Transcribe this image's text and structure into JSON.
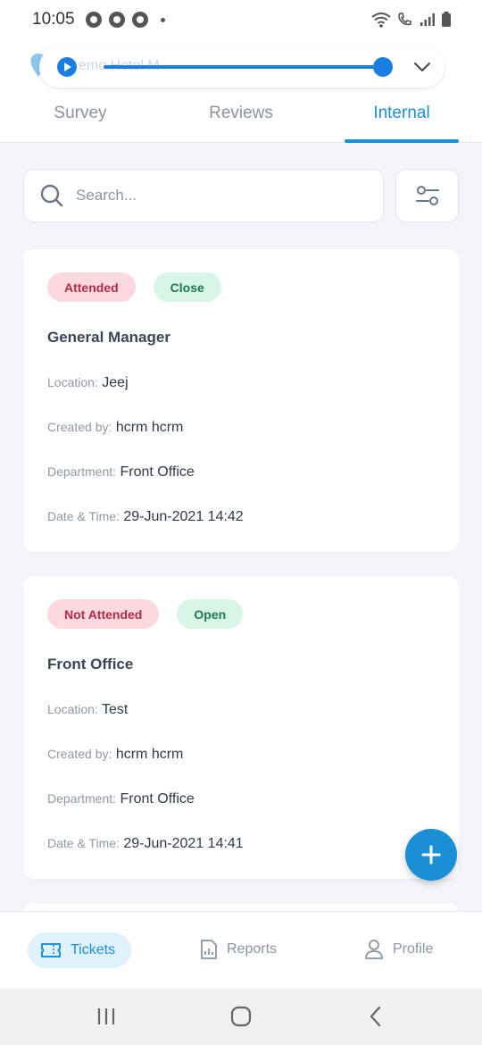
{
  "status_bar": {
    "time": "10:05"
  },
  "audio_player": {
    "title_partial": "emo Hotel M"
  },
  "tabs": [
    {
      "label": "Survey"
    },
    {
      "label": "Reviews"
    },
    {
      "label": "Internal"
    }
  ],
  "search": {
    "placeholder": "Search..."
  },
  "tickets": [
    {
      "status": "Attended",
      "state": "Close",
      "title": "General Manager",
      "location_label": "Location:",
      "location": "Jeej",
      "created_by_label": "Created by:",
      "created_by": "hcrm hcrm",
      "department_label": "Department:",
      "department": "Front Office",
      "datetime_label": "Date & Time:",
      "datetime": "29-Jun-2021 14:42"
    },
    {
      "status": "Not Attended",
      "state": "Open",
      "title": "Front Office",
      "location_label": "Location:",
      "location": "Test",
      "created_by_label": "Created by:",
      "created_by": "hcrm hcrm",
      "department_label": "Department:",
      "department": "Front Office",
      "datetime_label": "Date & Time:",
      "datetime": "29-Jun-2021 14:41"
    }
  ],
  "bottom_nav": {
    "tickets": "Tickets",
    "reports": "Reports",
    "profile": "Profile"
  },
  "colors": {
    "accent": "#1b8fd6",
    "badge_red_bg": "#fbd9df",
    "badge_red_text": "#b32b44",
    "badge_green_bg": "#d7f6e8",
    "badge_green_text": "#1e7a4e"
  }
}
